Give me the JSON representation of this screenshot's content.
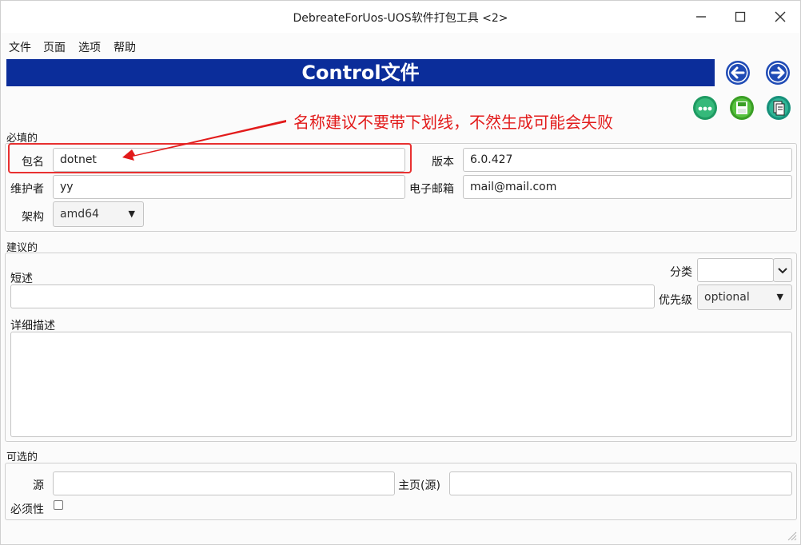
{
  "window": {
    "title": "DebreateForUos-UOS软件打包工具 <2>"
  },
  "menu": [
    "文件",
    "页面",
    "选项",
    "帮助"
  ],
  "banner": {
    "title": "Control文件"
  },
  "annotation": {
    "text": "名称建议不要带下划线，不然生成可能会失败",
    "color": "#e21b1b"
  },
  "colors": {
    "banner_bg": "#0b2d9a",
    "nav_blue": "#1f4bb5",
    "tool_green": "#2aa36b"
  },
  "required": {
    "section_label": "必填的",
    "package_label": "包名",
    "package_value": "dotnet",
    "version_label": "版本",
    "version_value": "6.0.427",
    "maintainer_label": "维护者",
    "maintainer_value": "yy",
    "email_label": "电子邮箱",
    "email_value": "mail@mail.com",
    "arch_label": "架构",
    "arch_value": "amd64"
  },
  "recommended": {
    "section_label": "建议的",
    "category_label": "分类",
    "category_value": "",
    "short_label": "短述",
    "short_value": "",
    "priority_label": "优先级",
    "priority_value": "optional",
    "long_label": "详细描述",
    "long_value": ""
  },
  "optional": {
    "section_label": "可选的",
    "source_label": "源",
    "source_value": "",
    "homepage_label": "主页(源)",
    "homepage_value": "",
    "essential_label": "必须性",
    "essential_checked": false
  }
}
